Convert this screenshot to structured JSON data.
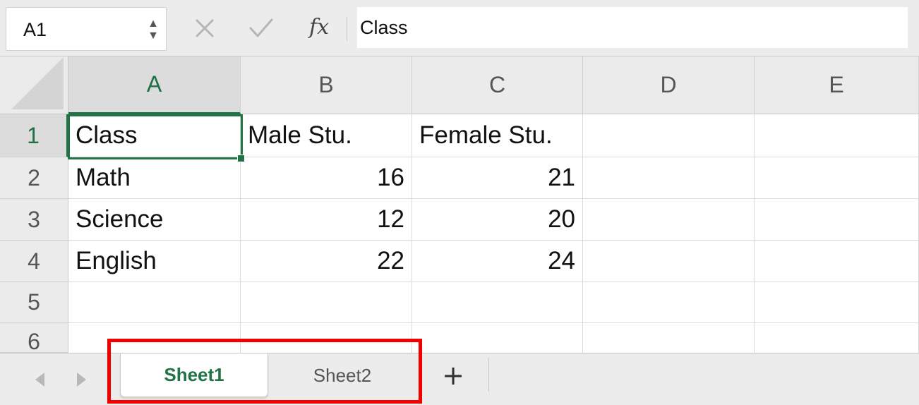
{
  "formula_bar": {
    "name_box": "A1",
    "stepper_up": "▲",
    "stepper_down": "▼",
    "fx_label": "fx",
    "content": "Class"
  },
  "columns": [
    "A",
    "B",
    "C",
    "D",
    "E"
  ],
  "rows": [
    "1",
    "2",
    "3",
    "4",
    "5",
    "6"
  ],
  "cells": {
    "A1": "Class",
    "B1": "Male Stu.",
    "C1": "Female Stu.",
    "A2": "Math",
    "B2": "16",
    "C2": "21",
    "A3": "Science",
    "B3": "12",
    "C3": "20",
    "A4": "English",
    "B4": "22",
    "C4": "24"
  },
  "selected_cell": "A1",
  "sheet_tabs": [
    "Sheet1",
    "Sheet2"
  ],
  "active_sheet": "Sheet1",
  "add_sheet_label": "+",
  "colors": {
    "accent_green": "#217346",
    "highlight_red": "#f20000"
  },
  "icons": [
    "cancel-icon",
    "confirm-icon",
    "fx-icon",
    "nav-prev-icon",
    "nav-next-icon",
    "add-sheet-icon"
  ]
}
